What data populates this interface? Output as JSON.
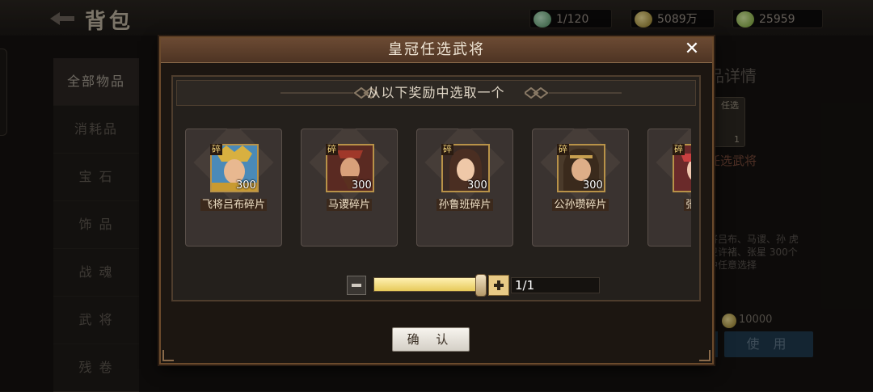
{
  "topbar": {
    "back_icon": "back-arrow-icon",
    "title": "背包",
    "resources": [
      {
        "icon": "bag-capacity-icon",
        "value": "1/120"
      },
      {
        "icon": "gold-coin-icon",
        "value": "5089万"
      },
      {
        "icon": "ingot-icon",
        "value": "25959"
      }
    ]
  },
  "sidebar": {
    "items": [
      {
        "label": "全部物品",
        "active": true
      },
      {
        "label": "消耗品"
      },
      {
        "label": "宝 石"
      },
      {
        "label": "饰 品"
      },
      {
        "label": "战 魂"
      },
      {
        "label": "武 将"
      },
      {
        "label": "残 卷"
      }
    ]
  },
  "detail": {
    "title": "品详情",
    "icon_tag": "任选",
    "count": "1",
    "name": "任选武将",
    "description": "将吕布、马谡、孙 虎卫许褚、张星 300个中任意选择",
    "price": "10000",
    "use_label": "使 用"
  },
  "modal": {
    "title": "皇冠任选武将",
    "close_icon": "close-icon",
    "subtitle": "从以下奖励中选取一个",
    "items": [
      {
        "name": "飞将吕布碎片",
        "qty": "300",
        "badge": "碎"
      },
      {
        "name": "马谡碎片",
        "qty": "300",
        "badge": "碎"
      },
      {
        "name": "孙鲁班碎片",
        "qty": "300",
        "badge": "碎"
      },
      {
        "name": "公孙瓒碎片",
        "qty": "300",
        "badge": "碎"
      },
      {
        "name": "张星",
        "qty": "",
        "badge": "碎"
      }
    ],
    "selector": {
      "count_text": "1/1",
      "fill_fraction": 1.0
    },
    "confirm_label": "确 认"
  },
  "colors": {
    "modal_header": "#5c3f2b",
    "slider_fill": "#f2dd86",
    "use_button": "#203a4d"
  }
}
